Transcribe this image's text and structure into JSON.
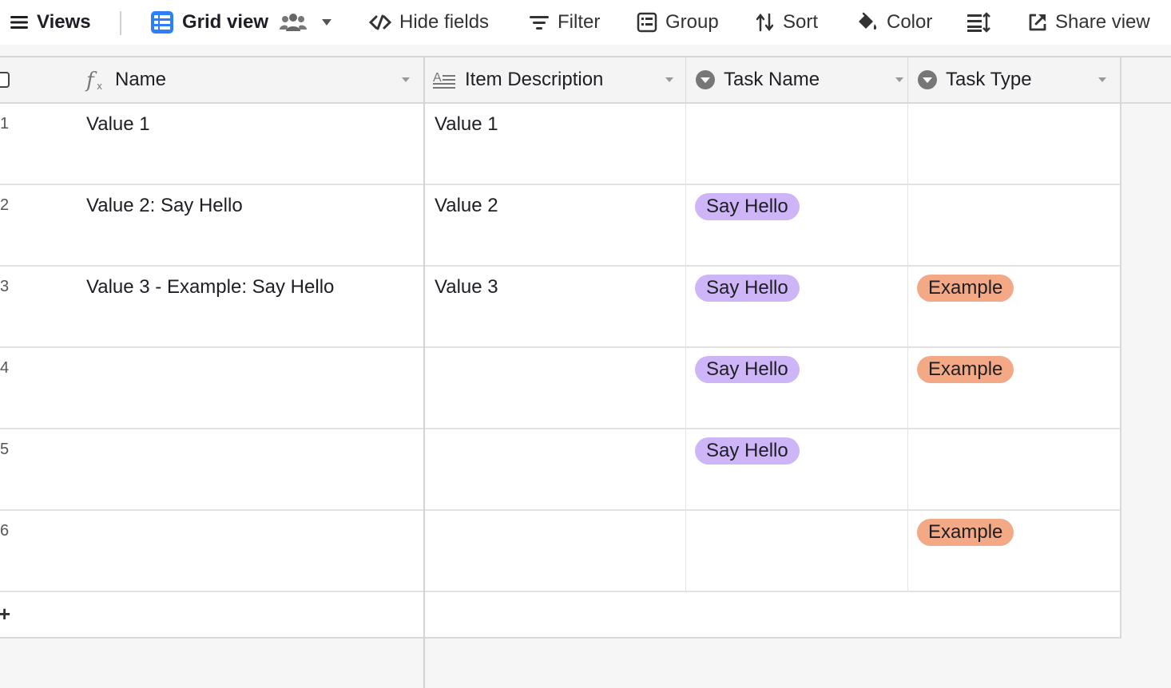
{
  "toolbar": {
    "views_label": "Views",
    "grid_view_label": "Grid view",
    "hide_fields_label": "Hide fields",
    "filter_label": "Filter",
    "group_label": "Group",
    "sort_label": "Sort",
    "color_label": "Color",
    "share_view_label": "Share view"
  },
  "columns": {
    "name": "Name",
    "item_description": "Item Description",
    "task_name": "Task Name",
    "task_type": "Task Type"
  },
  "rows": [
    {
      "num": "1",
      "name": "Value 1",
      "description": "Value 1",
      "task_name": "",
      "task_type": ""
    },
    {
      "num": "2",
      "name": "Value 2: Say Hello",
      "description": "Value 2",
      "task_name": "Say Hello",
      "task_type": ""
    },
    {
      "num": "3",
      "name": "Value 3 - Example: Say Hello",
      "description": "Value 3",
      "task_name": "Say Hello",
      "task_type": "Example"
    },
    {
      "num": "4",
      "name": "",
      "description": "",
      "task_name": "Say Hello",
      "task_type": "Example"
    },
    {
      "num": "5",
      "name": "",
      "description": "",
      "task_name": "Say Hello",
      "task_type": ""
    },
    {
      "num": "6",
      "name": "",
      "description": "",
      "task_name": "",
      "task_type": "Example"
    }
  ],
  "add_row_symbol": "+",
  "colors": {
    "accent_blue": "#2d7ff9",
    "pill_purple": "#cdb5f7",
    "pill_orange": "#f3a886"
  }
}
